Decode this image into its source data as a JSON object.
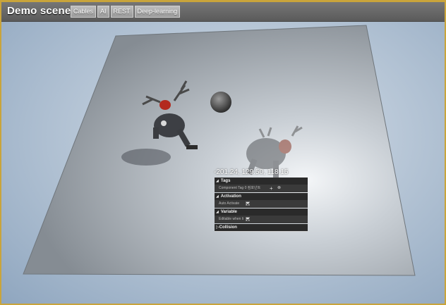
{
  "header": {
    "title": "Demo scenes"
  },
  "tabs": [
    {
      "label": "Cables"
    },
    {
      "label": "AI"
    },
    {
      "label": "REST"
    },
    {
      "label": "Deep-learning"
    }
  ],
  "viewport": {
    "coordinates": "-201.24, 129.50, 118.15"
  },
  "details_panel": {
    "sections": [
      {
        "title": "Tags",
        "row_label": "Component Tag 0 컴포넌트"
      },
      {
        "title": "Activation",
        "row_label": "Auto Activate"
      },
      {
        "title": "Variable",
        "row_label": "Editable when li"
      },
      {
        "title": "Collision"
      }
    ]
  },
  "colors": {
    "accent_border": "#c9a43b",
    "sky": "#b8c7d7",
    "floor": "#9fa7ae"
  }
}
